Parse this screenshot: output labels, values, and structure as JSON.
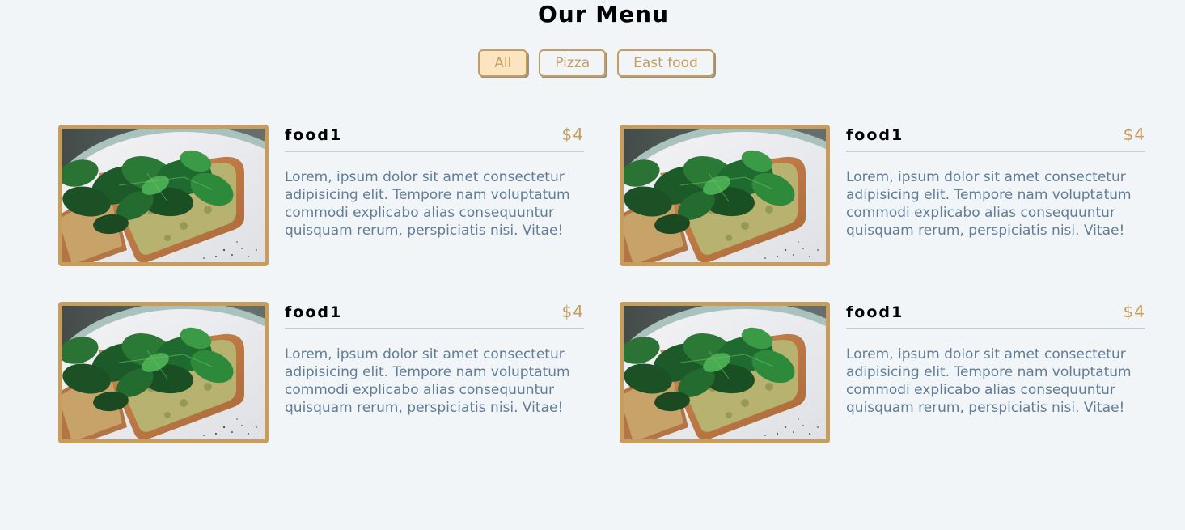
{
  "page": {
    "title": "Our Menu"
  },
  "filters": [
    {
      "label": "All",
      "active": true
    },
    {
      "label": "Pizza",
      "active": false
    },
    {
      "label": "East food",
      "active": false
    }
  ],
  "colors": {
    "accent": "#c59d5f",
    "background": "#f1f5f8",
    "text_muted": "#617d98",
    "active_filter_bg": "#fbe4c0"
  },
  "menu": {
    "items": [
      {
        "name": "food1",
        "price": "$4",
        "description": "Lorem, ipsum dolor sit amet consectetur adipisicing elit. Tempore nam voluptatum commodi explicabo alias consequuntur quisquam rerum, perspiciatis nisi. Vitae!",
        "image": "avocado-toast-with-spinach"
      },
      {
        "name": "food1",
        "price": "$4",
        "description": "Lorem, ipsum dolor sit amet consectetur adipisicing elit. Tempore nam voluptatum commodi explicabo alias consequuntur quisquam rerum, perspiciatis nisi. Vitae!",
        "image": "avocado-toast-with-spinach"
      },
      {
        "name": "food1",
        "price": "$4",
        "description": "Lorem, ipsum dolor sit amet consectetur adipisicing elit. Tempore nam voluptatum commodi explicabo alias consequuntur quisquam rerum, perspiciatis nisi. Vitae!",
        "image": "avocado-toast-with-spinach"
      },
      {
        "name": "food1",
        "price": "$4",
        "description": "Lorem, ipsum dolor sit amet consectetur adipisicing elit. Tempore nam voluptatum commodi explicabo alias consequuntur quisquam rerum, perspiciatis nisi. Vitae!",
        "image": "avocado-toast-with-spinach"
      }
    ]
  }
}
